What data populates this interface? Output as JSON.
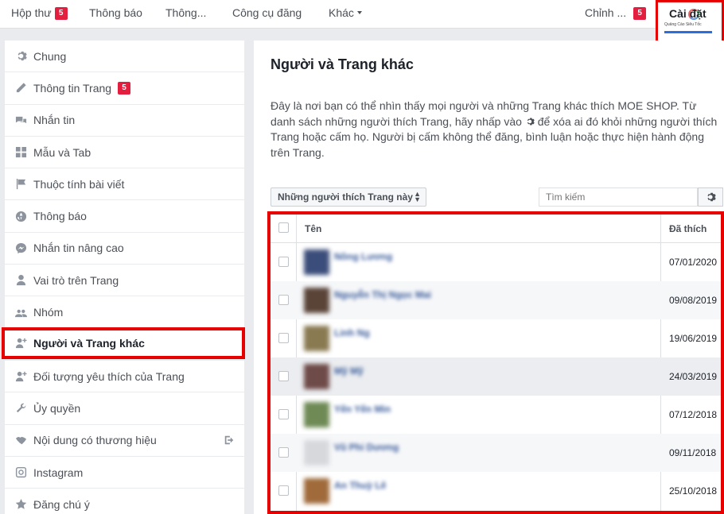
{
  "topnav": {
    "inbox": {
      "label": "Hộp thư",
      "badge": "5"
    },
    "notifications": "Thông báo",
    "insights": "Thông...",
    "publishing_tools": "Công cụ đăng",
    "more": "Khác",
    "edit": {
      "label": "Chỉnh ...",
      "badge": "5"
    },
    "settings": "Cài đặt",
    "logo_text": "Quảng Cáo Siêu Tốc"
  },
  "sidebar": {
    "items": [
      {
        "label": "Chung",
        "icon": "gear-icon"
      },
      {
        "label": "Thông tin Trang",
        "icon": "pencil-icon",
        "badge": "5"
      },
      {
        "label": "Nhắn tin",
        "icon": "chat-bubbles-icon"
      },
      {
        "label": "Mẫu và Tab",
        "icon": "grid-icon"
      },
      {
        "label": "Thuộc tính bài viết",
        "icon": "flag-icon"
      },
      {
        "label": "Thông báo",
        "icon": "globe-icon"
      },
      {
        "label": "Nhắn tin nâng cao",
        "icon": "messenger-icon"
      },
      {
        "label": "Vai trò trên Trang",
        "icon": "person-icon"
      },
      {
        "label": "Nhóm",
        "icon": "group-icon"
      },
      {
        "label": "Người và Trang khác",
        "icon": "person-add-icon",
        "active": true
      },
      {
        "label": "Đối tượng yêu thích của Trang",
        "icon": "person-add-icon"
      },
      {
        "label": "Ủy quyền",
        "icon": "wrench-icon"
      },
      {
        "label": "Nội dung có thương hiệu",
        "icon": "handshake-icon"
      },
      {
        "label": "Instagram",
        "icon": "instagram-icon"
      },
      {
        "label": "Đăng chú ý",
        "icon": "star-icon"
      }
    ]
  },
  "main": {
    "title": "Người và Trang khác",
    "description_part1": "Đây là nơi bạn có thể nhìn thấy mọi người và những Trang khác thích MOE SHOP. Từ danh sách những người thích Trang, hãy nhấp vào",
    "description_part2": "để xóa ai đó khỏi những người thích Trang hoặc cấm họ. Người bị cấm không thể đăng, bình luận hoặc thực hiện hành động trên Trang.",
    "filter": "Những người thích Trang này",
    "search_placeholder": "Tìm kiếm",
    "table": {
      "col_name": "Tên",
      "col_date": "Đã thích",
      "rows": [
        {
          "name": "Nông Lương",
          "date": "07/01/2020",
          "avatar": "#3b4d7a"
        },
        {
          "name": "Nguyễn Thị Ngọc Mai",
          "date": "09/08/2019",
          "avatar": "#5a4438"
        },
        {
          "name": "Linh Ng",
          "date": "19/06/2019",
          "avatar": "#8a7a52"
        },
        {
          "name": "Mỹ Mỹ",
          "date": "24/03/2019",
          "avatar": "#6e4a48"
        },
        {
          "name": "Yến Yến Min",
          "date": "07/12/2018",
          "avatar": "#6f8a55"
        },
        {
          "name": "Vũ Phi Dương",
          "date": "09/11/2018",
          "avatar": "#d6d8dc"
        },
        {
          "name": "An Thuỳ Lê",
          "date": "25/10/2018",
          "avatar": "#a06a3a"
        }
      ]
    }
  }
}
